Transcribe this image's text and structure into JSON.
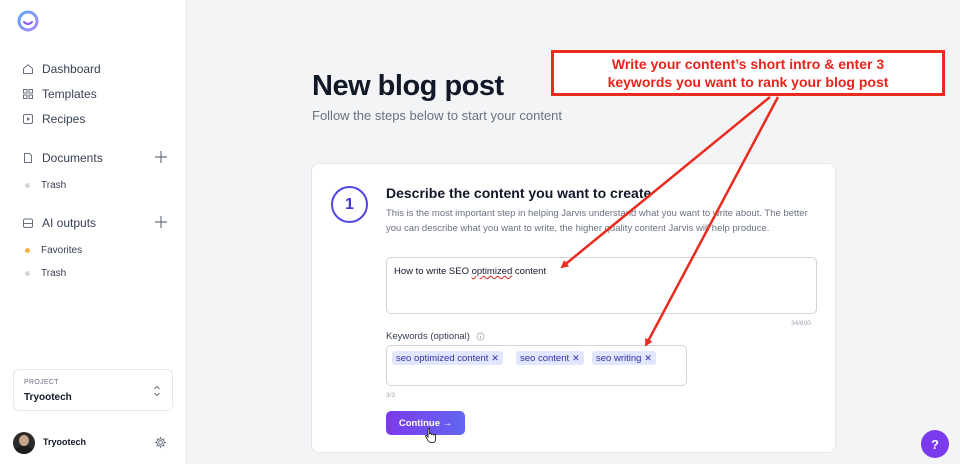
{
  "sidebar": {
    "nav": [
      {
        "label": "Dashboard",
        "icon": "home-icon"
      },
      {
        "label": "Templates",
        "icon": "grid-icon"
      },
      {
        "label": "Recipes",
        "icon": "play-square-icon"
      }
    ],
    "documents_label": "Documents",
    "documents_trash": "Trash",
    "ai_outputs_label": "AI outputs",
    "favorites_label": "Favorites",
    "ai_trash": "Trash",
    "project_label": "PROJECT",
    "project_name": "Tryootech",
    "user_name": "Tryootech"
  },
  "main": {
    "title": "New blog post",
    "subtitle": "Follow the steps below to start your content"
  },
  "step": {
    "number": "1",
    "title": "Describe the content you want to create",
    "description": "This is the most important step in helping Jarvis understand what you want to write about. The better you can describe what you want to write, the higher quality content Jarvis will help produce.",
    "content_prefix": "How to write SEO ",
    "content_misspelled": "optimized",
    "content_suffix": " content",
    "char_count": "34/600",
    "keywords_label": "Keywords (optional)",
    "keywords": [
      "seo optimized content",
      "seo content",
      "seo writing"
    ],
    "keyword_count": "3/3",
    "continue_label": "Continue →"
  },
  "annotation": {
    "line1": "Write your content’s short intro & enter 3",
    "line2": "keywords you want to rank your blog post"
  },
  "help_label": "?",
  "colors": {
    "accent": "#7c3aed",
    "annotation": "#e8231c",
    "chip_bg": "#e0e7ff"
  }
}
